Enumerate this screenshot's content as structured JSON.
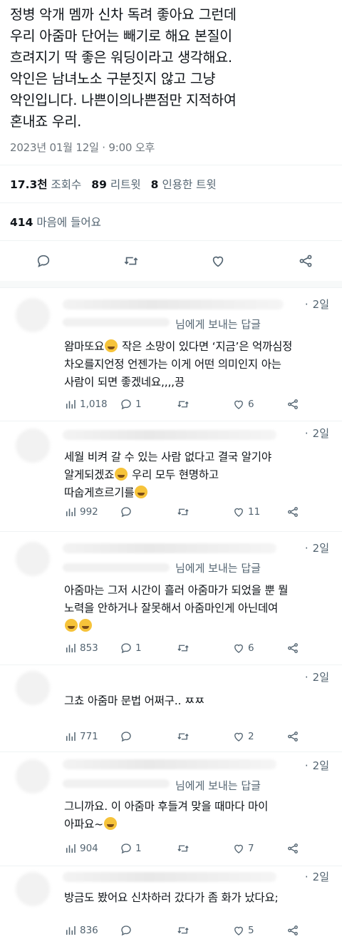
{
  "tweet": {
    "text": "정병 악개 멤까 신차 독려 좋아요 그런데\n우리 아줌마 단어는 빼기로 해요 본질이\n흐려지기 딱 좋은 워딩이라고 생각해요.\n악인은 남녀노소 구분짓지 않고 그냥\n악인입니다. 나쁜이의나쁜점만 지적하여\n혼내죠 우리.",
    "timestamp": "2023년 01월 12일 · 9:00 오후"
  },
  "stats": {
    "views_value": "17.3천",
    "views_label": "조회수",
    "retweets_value": "89",
    "retweets_label": "리트윗",
    "quotes_value": "8",
    "quotes_label": "인용한 트윗",
    "likes_value": "414",
    "likes_label": "마음에 들어요"
  },
  "colors": {
    "text": "#0f1419",
    "secondary": "#536471",
    "divider": "#eff3f4"
  },
  "replies": [
    {
      "time": "2일",
      "replying_to": "님에게 보내는 답글",
      "text_before": "왐마또요",
      "text_after": " 작은 소망이 있다면 ‘지금’은 억까심정\n차오를지언정 언젠가는 이게 어떤 의미인지 아는\n사람이 되면 좋겠네요,,,,끙",
      "views": "1,018",
      "replies": "1",
      "retweets": "",
      "likes": "6"
    },
    {
      "time": "2일",
      "replying_to": "",
      "text_before": "세월 비켜 갈 수 있는 사람 없다고 결국 알기야\n알게되겠죠",
      "text_after": " 우리 모두 현명하고\n따숩게흐르기를",
      "views": "992",
      "replies": "",
      "retweets": "",
      "likes": "11"
    },
    {
      "time": "2일",
      "replying_to": "님에게 보내는 답글",
      "text_before": "아줌마는 그저 시간이 흘러 아줌마가 되었을 뿐 뭘\n노력을 안하거나 잘못해서 아줌마인게 아닌데여\n",
      "text_after": "",
      "views": "853",
      "replies": "1",
      "retweets": "",
      "likes": "6"
    },
    {
      "time": "2일",
      "replying_to": "",
      "text_before": "그쵸 아줌마 문법 어쩌구.. ㅉㅉ",
      "text_after": "",
      "views": "771",
      "replies": "",
      "retweets": "",
      "likes": "2"
    },
    {
      "time": "2일",
      "replying_to": "님에게 보내는 답글",
      "text_before": "그니까요. 이 아줌마 후들겨 맞을 때마다 마이\n아파요~",
      "text_after": "",
      "views": "904",
      "replies": "1",
      "retweets": "",
      "likes": "7"
    },
    {
      "time": "2일",
      "replying_to": "",
      "text_before": "방금도 봤어요 신차하러 갔다가 좀 화가 났다요;",
      "text_after": "",
      "views": "836",
      "replies": "",
      "retweets": "",
      "likes": "5"
    }
  ]
}
